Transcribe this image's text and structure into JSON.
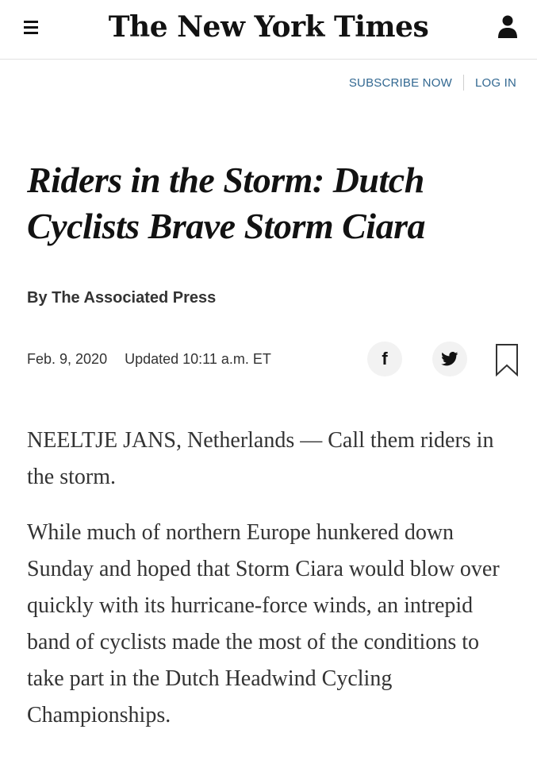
{
  "header": {
    "logo_text": "The New York Times",
    "menu_icon": "hamburger-menu-icon",
    "account_icon": "user-account-icon",
    "subscribe_label": "SUBSCRIBE NOW",
    "login_label": "LOG IN"
  },
  "article": {
    "headline": "Riders in the Storm: Dutch Cyclists Brave Storm Ciara",
    "byline": "By The Associated Press",
    "date": "Feb. 9, 2020",
    "updated": "Updated 10:11 a.m. ET",
    "share_icons": [
      "facebook-icon",
      "twitter-icon",
      "bookmark-icon"
    ],
    "paragraphs": [
      "NEELTJE JANS, Netherlands — Call them riders in the storm.",
      "While much of northern Europe hunkered down Sunday and hoped that Storm Ciara would blow over quickly with its hurricane-force winds, an intrepid band of cyclists made the most of the conditions to take part in the Dutch Headwind Cycling Championships."
    ]
  },
  "colors": {
    "link": "#326891",
    "text": "#121212",
    "body_text": "#333333",
    "share_button_bg": "#f2f2f2",
    "divider": "#e2e2e2"
  }
}
